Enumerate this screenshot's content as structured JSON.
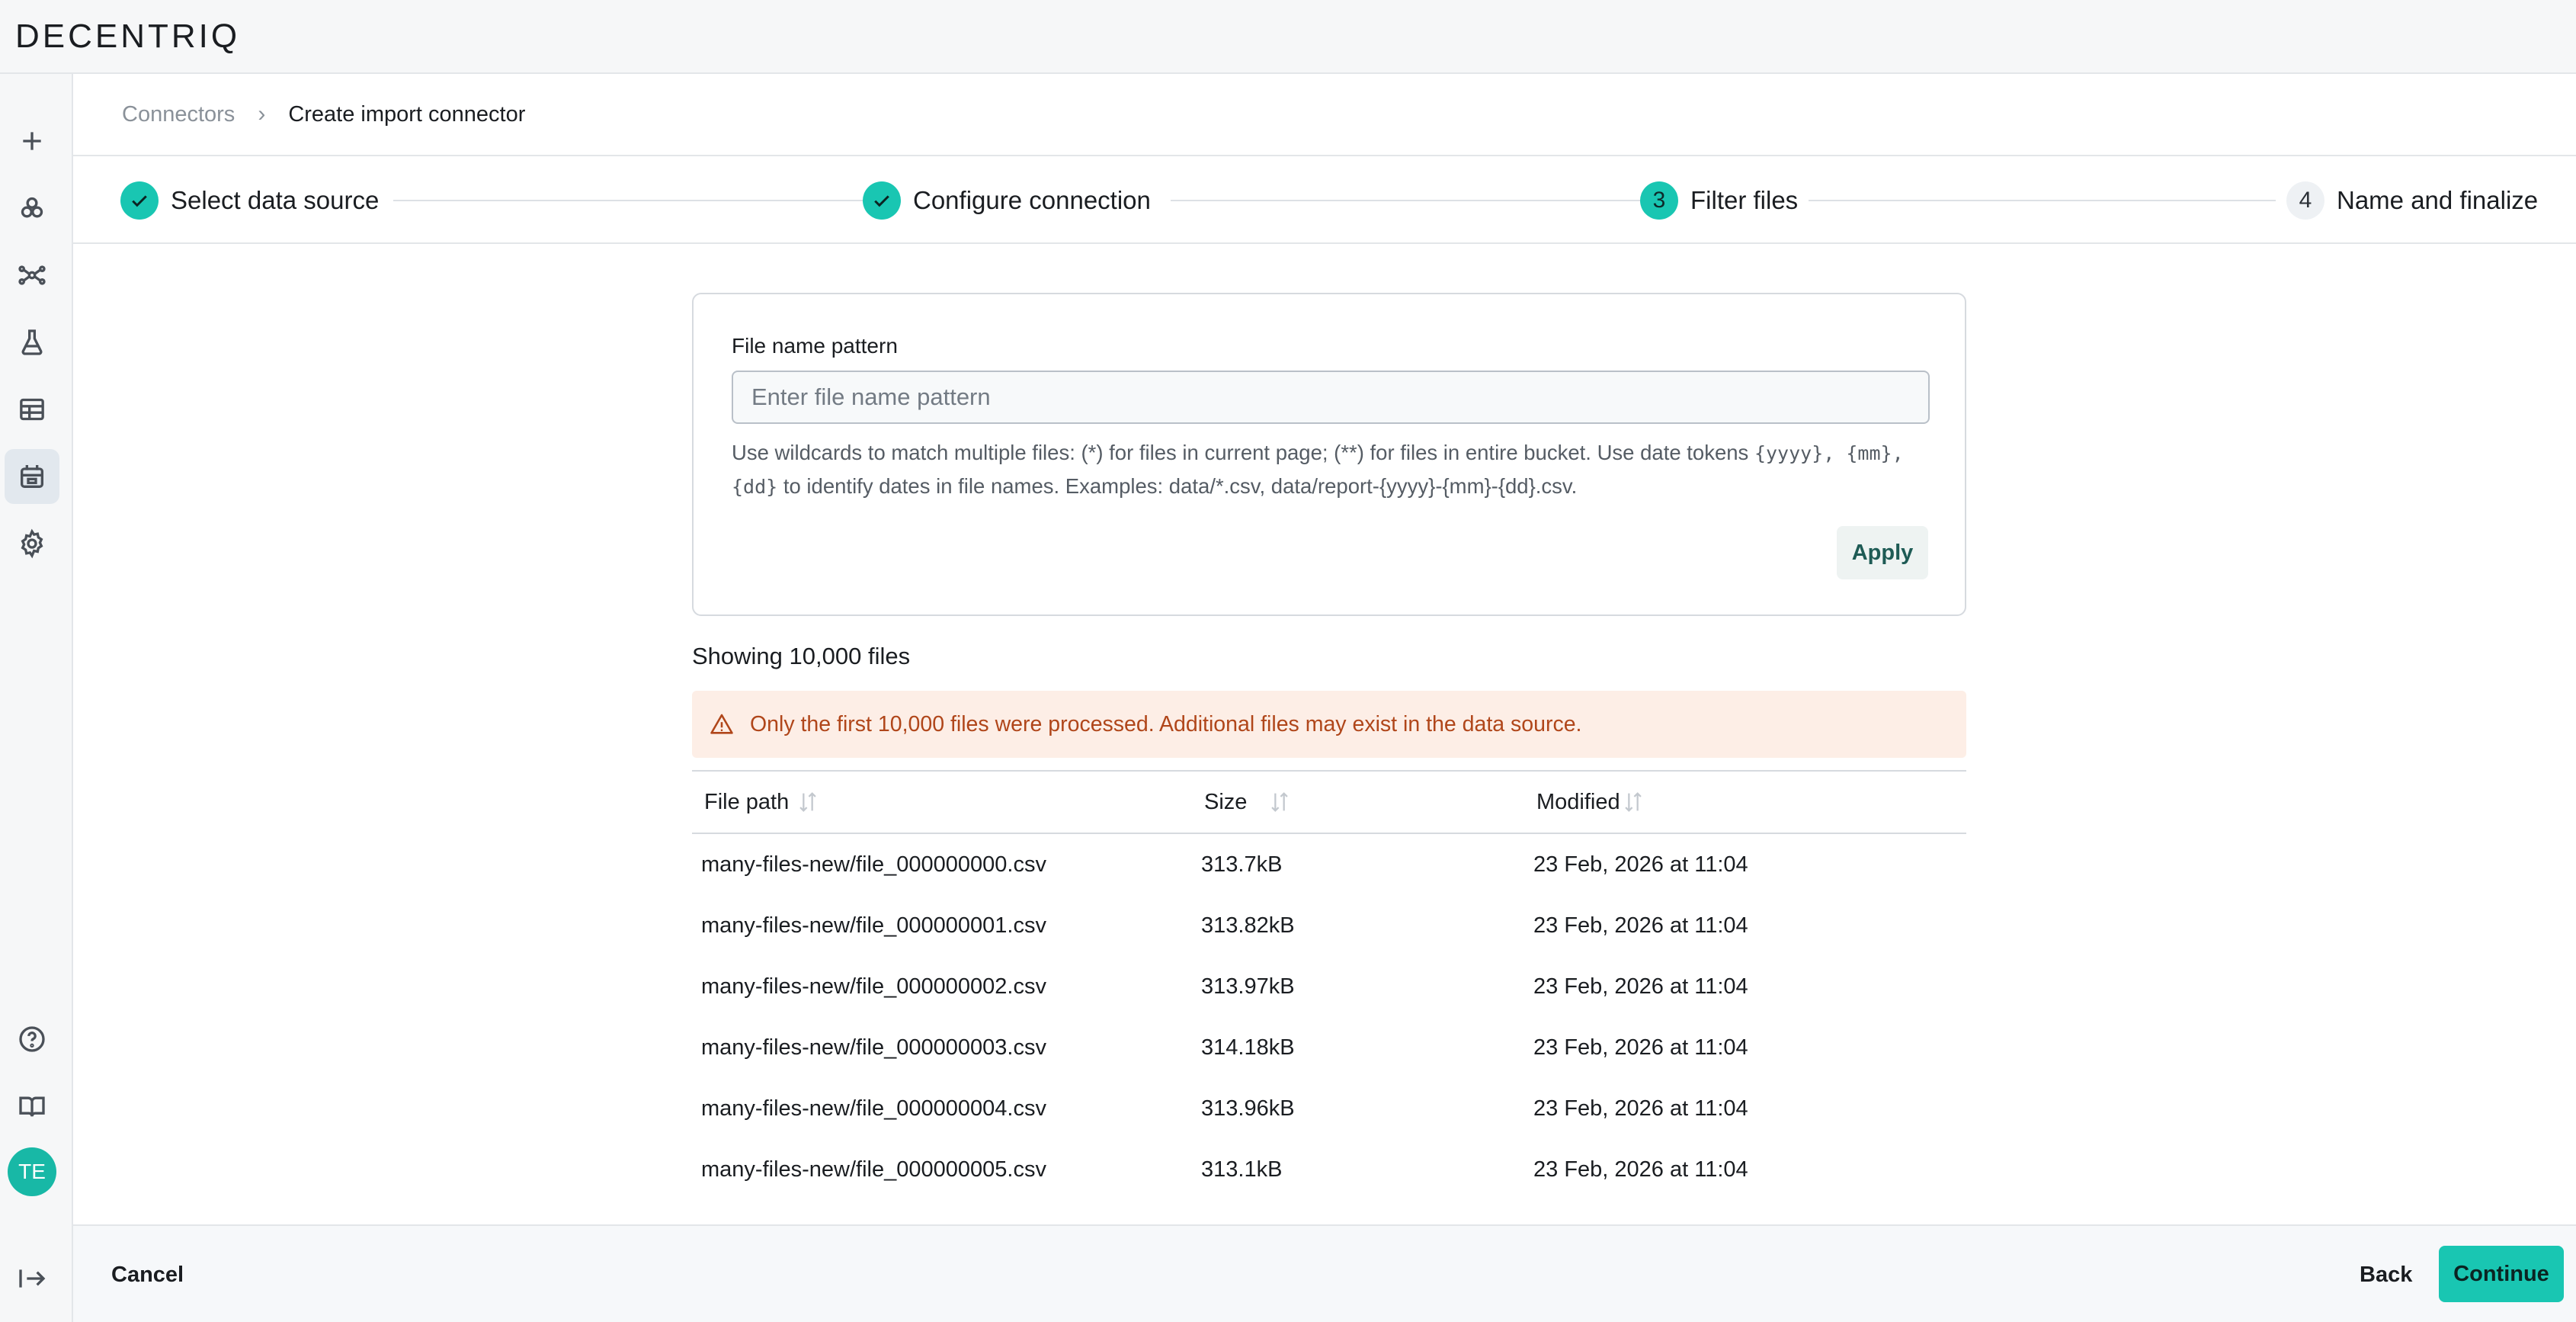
{
  "app": {
    "logo": "DECENTRIQ"
  },
  "sidebar": {
    "items": [
      {
        "icon": "plus-icon"
      },
      {
        "icon": "data-clean-rooms-icon"
      },
      {
        "icon": "network-icon"
      },
      {
        "icon": "flask-icon"
      },
      {
        "icon": "table-icon"
      },
      {
        "icon": "connectors-icon",
        "active": true
      },
      {
        "icon": "gear-icon"
      }
    ],
    "bottom": [
      {
        "icon": "help-icon"
      },
      {
        "icon": "book-icon"
      }
    ],
    "avatar": "TE",
    "collapse_icon": "collapse-sidebar-icon"
  },
  "breadcrumb": {
    "parent": "Connectors",
    "current": "Create import connector"
  },
  "stepper": {
    "steps": [
      {
        "number": "",
        "label": "Select data source",
        "state": "done"
      },
      {
        "number": "",
        "label": "Configure connection",
        "state": "done"
      },
      {
        "number": "3",
        "label": "Filter files",
        "state": "current"
      },
      {
        "number": "4",
        "label": "Name and finalize",
        "state": "todo"
      }
    ]
  },
  "filter": {
    "label": "File name pattern",
    "placeholder": "Enter file name pattern",
    "value": "",
    "help_prefix": "Use wildcards to match multiple files: (*) for files in current page; (**) for files in entire bucket. Use date tokens",
    "help_tokens": "{yyyy}, {mm}, {dd}",
    "help_suffix": "to identify dates in file names. Examples: data/*.csv, data/report-{yyyy}-{mm}-{dd}.csv.",
    "apply_label": "Apply"
  },
  "results": {
    "showing": "Showing 10,000 files",
    "alert": "Only the first 10,000 files were processed. Additional files may exist in the data source.",
    "columns": {
      "path": "File path",
      "size": "Size",
      "modified": "Modified"
    },
    "rows": [
      {
        "path": "many-files-new/file_000000000.csv",
        "size": "313.7kB",
        "modified": "23 Feb, 2026 at 11:04"
      },
      {
        "path": "many-files-new/file_000000001.csv",
        "size": "313.82kB",
        "modified": "23 Feb, 2026 at 11:04"
      },
      {
        "path": "many-files-new/file_000000002.csv",
        "size": "313.97kB",
        "modified": "23 Feb, 2026 at 11:04"
      },
      {
        "path": "many-files-new/file_000000003.csv",
        "size": "314.18kB",
        "modified": "23 Feb, 2026 at 11:04"
      },
      {
        "path": "many-files-new/file_000000004.csv",
        "size": "313.96kB",
        "modified": "23 Feb, 2026 at 11:04"
      },
      {
        "path": "many-files-new/file_000000005.csv",
        "size": "313.1kB",
        "modified": "23 Feb, 2026 at 11:04"
      }
    ]
  },
  "footer": {
    "cancel": "Cancel",
    "back": "Back",
    "continue": "Continue"
  },
  "colors": {
    "accent": "#19c6b2",
    "alert_bg": "#fdeee6",
    "alert_text": "#b0461a"
  }
}
